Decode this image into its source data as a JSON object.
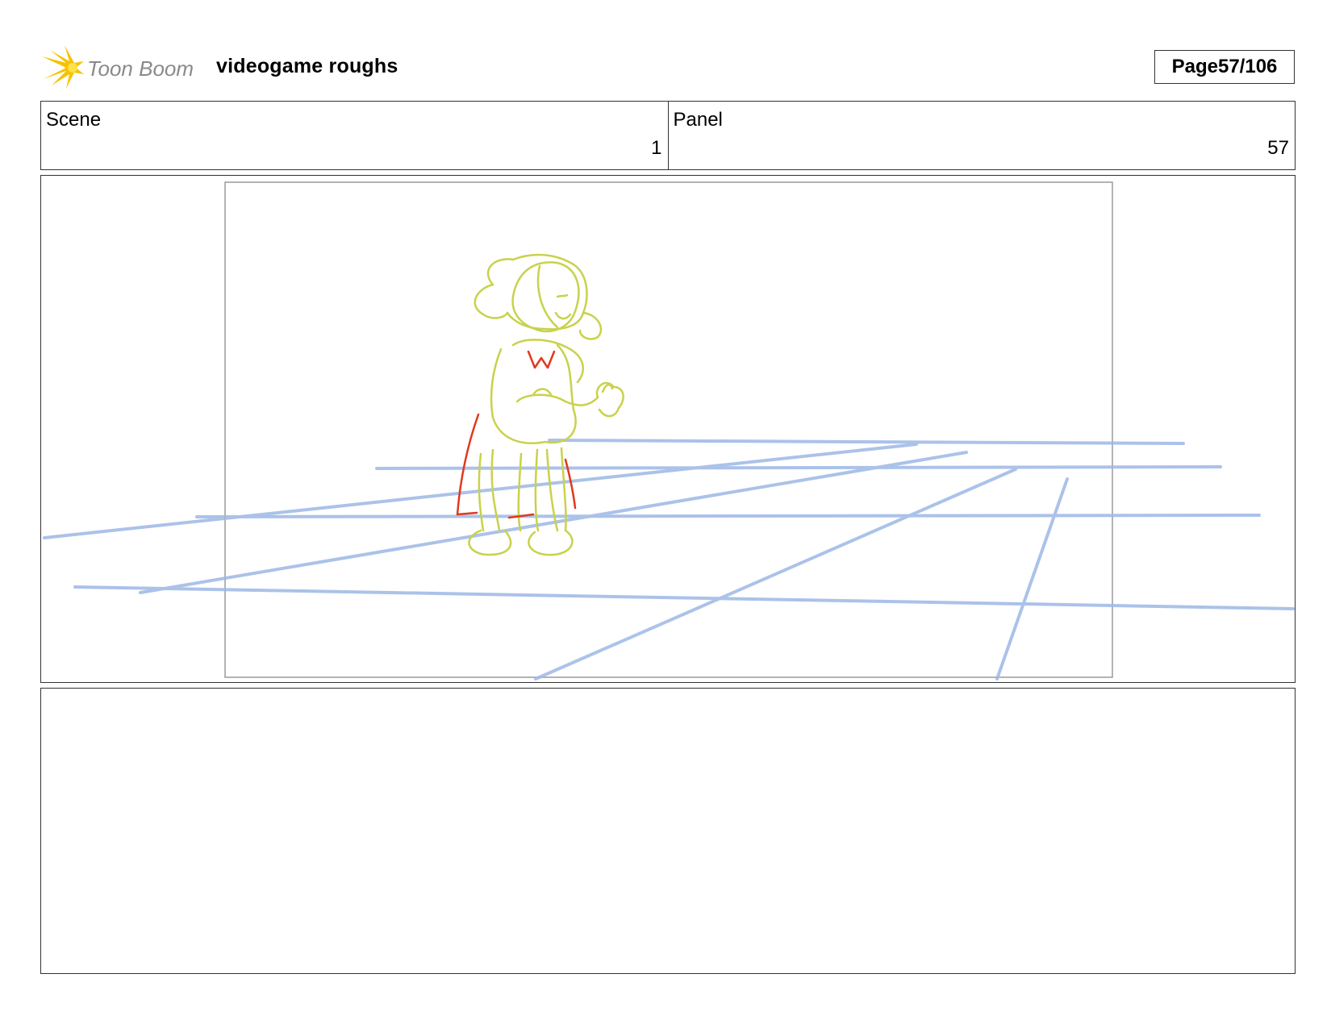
{
  "header": {
    "logo_text": "Toon Boom",
    "document_title": "videogame roughs",
    "page_label": "Page",
    "page_number": "57/106"
  },
  "meta": {
    "scene": {
      "label": "Scene",
      "value": "1"
    },
    "panel": {
      "label": "Panel",
      "value": "57"
    }
  },
  "colors": {
    "logo_accent": "#f5c400",
    "sketch_green": "#c8d24a",
    "sketch_red": "#e0391c",
    "guide_blue": "#9db8e6"
  },
  "panel_image": {
    "subject": "rough sketch of a girl standing on a blue perspective grid"
  }
}
